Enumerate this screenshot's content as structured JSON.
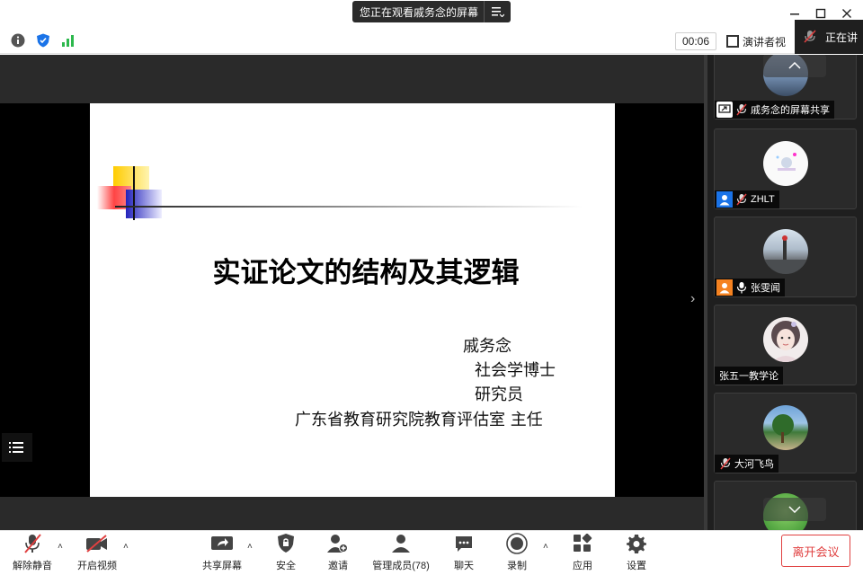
{
  "titlebar": {
    "share_notice": "您正在观看戚务念的屏幕"
  },
  "infobar": {
    "timer": "00:06",
    "speaker_view_label": "演讲者视",
    "speaking_label": "正在讲"
  },
  "slide": {
    "title": "实证论文的结构及其逻辑",
    "lines": [
      "戚务念",
      "社会学博士",
      "研究员",
      "广东省教育研究院教育评估室  主任"
    ]
  },
  "participants": [
    {
      "name": "戚务念的屏幕共享",
      "badge": "screen-share",
      "mic": "muted"
    },
    {
      "name": "ZHLT",
      "badge": "user-blue",
      "mic": "muted"
    },
    {
      "name": "张雯闻",
      "badge": "user-orange",
      "mic": "on"
    },
    {
      "name": "张五一教学论",
      "badge": "",
      "mic": ""
    },
    {
      "name": "大河飞鸟",
      "badge": "",
      "mic": "muted"
    }
  ],
  "toolbar": {
    "unmute": "解除静音",
    "start_video": "开启视频",
    "share_screen": "共享屏幕",
    "security": "安全",
    "invite": "邀请",
    "participants": "管理成员(78)",
    "chat": "聊天",
    "record": "录制",
    "apps": "应用",
    "settings": "设置",
    "leave": "离开会议"
  },
  "colors": {
    "accent_red": "#e04040",
    "signal_green": "#2db84d",
    "shield_blue": "#1a73e8",
    "user_blue": "#1a73e8",
    "user_orange": "#f58220"
  }
}
